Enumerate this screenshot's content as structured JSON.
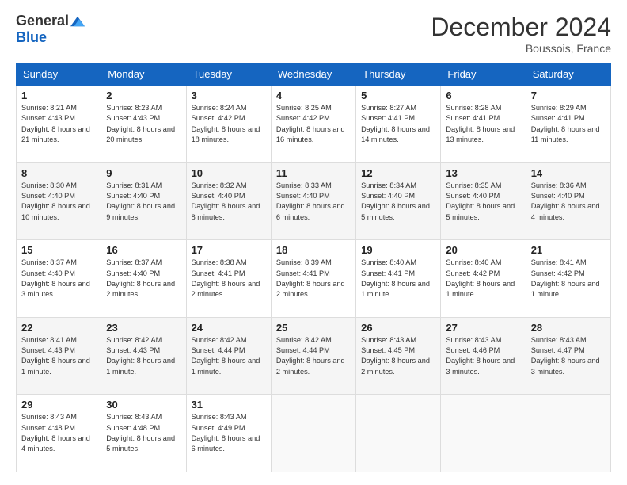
{
  "header": {
    "logo_general": "General",
    "logo_blue": "Blue",
    "title": "December 2024",
    "subtitle": "Boussois, France"
  },
  "days_of_week": [
    "Sunday",
    "Monday",
    "Tuesday",
    "Wednesday",
    "Thursday",
    "Friday",
    "Saturday"
  ],
  "weeks": [
    [
      {
        "day": "1",
        "sunrise": "8:21 AM",
        "sunset": "4:43 PM",
        "daylight": "8 hours and 21 minutes."
      },
      {
        "day": "2",
        "sunrise": "8:23 AM",
        "sunset": "4:43 PM",
        "daylight": "8 hours and 20 minutes."
      },
      {
        "day": "3",
        "sunrise": "8:24 AM",
        "sunset": "4:42 PM",
        "daylight": "8 hours and 18 minutes."
      },
      {
        "day": "4",
        "sunrise": "8:25 AM",
        "sunset": "4:42 PM",
        "daylight": "8 hours and 16 minutes."
      },
      {
        "day": "5",
        "sunrise": "8:27 AM",
        "sunset": "4:41 PM",
        "daylight": "8 hours and 14 minutes."
      },
      {
        "day": "6",
        "sunrise": "8:28 AM",
        "sunset": "4:41 PM",
        "daylight": "8 hours and 13 minutes."
      },
      {
        "day": "7",
        "sunrise": "8:29 AM",
        "sunset": "4:41 PM",
        "daylight": "8 hours and 11 minutes."
      }
    ],
    [
      {
        "day": "8",
        "sunrise": "8:30 AM",
        "sunset": "4:40 PM",
        "daylight": "8 hours and 10 minutes."
      },
      {
        "day": "9",
        "sunrise": "8:31 AM",
        "sunset": "4:40 PM",
        "daylight": "8 hours and 9 minutes."
      },
      {
        "day": "10",
        "sunrise": "8:32 AM",
        "sunset": "4:40 PM",
        "daylight": "8 hours and 8 minutes."
      },
      {
        "day": "11",
        "sunrise": "8:33 AM",
        "sunset": "4:40 PM",
        "daylight": "8 hours and 6 minutes."
      },
      {
        "day": "12",
        "sunrise": "8:34 AM",
        "sunset": "4:40 PM",
        "daylight": "8 hours and 5 minutes."
      },
      {
        "day": "13",
        "sunrise": "8:35 AM",
        "sunset": "4:40 PM",
        "daylight": "8 hours and 5 minutes."
      },
      {
        "day": "14",
        "sunrise": "8:36 AM",
        "sunset": "4:40 PM",
        "daylight": "8 hours and 4 minutes."
      }
    ],
    [
      {
        "day": "15",
        "sunrise": "8:37 AM",
        "sunset": "4:40 PM",
        "daylight": "8 hours and 3 minutes."
      },
      {
        "day": "16",
        "sunrise": "8:37 AM",
        "sunset": "4:40 PM",
        "daylight": "8 hours and 2 minutes."
      },
      {
        "day": "17",
        "sunrise": "8:38 AM",
        "sunset": "4:41 PM",
        "daylight": "8 hours and 2 minutes."
      },
      {
        "day": "18",
        "sunrise": "8:39 AM",
        "sunset": "4:41 PM",
        "daylight": "8 hours and 2 minutes."
      },
      {
        "day": "19",
        "sunrise": "8:40 AM",
        "sunset": "4:41 PM",
        "daylight": "8 hours and 1 minute."
      },
      {
        "day": "20",
        "sunrise": "8:40 AM",
        "sunset": "4:42 PM",
        "daylight": "8 hours and 1 minute."
      },
      {
        "day": "21",
        "sunrise": "8:41 AM",
        "sunset": "4:42 PM",
        "daylight": "8 hours and 1 minute."
      }
    ],
    [
      {
        "day": "22",
        "sunrise": "8:41 AM",
        "sunset": "4:43 PM",
        "daylight": "8 hours and 1 minute."
      },
      {
        "day": "23",
        "sunrise": "8:42 AM",
        "sunset": "4:43 PM",
        "daylight": "8 hours and 1 minute."
      },
      {
        "day": "24",
        "sunrise": "8:42 AM",
        "sunset": "4:44 PM",
        "daylight": "8 hours and 1 minute."
      },
      {
        "day": "25",
        "sunrise": "8:42 AM",
        "sunset": "4:44 PM",
        "daylight": "8 hours and 2 minutes."
      },
      {
        "day": "26",
        "sunrise": "8:43 AM",
        "sunset": "4:45 PM",
        "daylight": "8 hours and 2 minutes."
      },
      {
        "day": "27",
        "sunrise": "8:43 AM",
        "sunset": "4:46 PM",
        "daylight": "8 hours and 3 minutes."
      },
      {
        "day": "28",
        "sunrise": "8:43 AM",
        "sunset": "4:47 PM",
        "daylight": "8 hours and 3 minutes."
      }
    ],
    [
      {
        "day": "29",
        "sunrise": "8:43 AM",
        "sunset": "4:48 PM",
        "daylight": "8 hours and 4 minutes."
      },
      {
        "day": "30",
        "sunrise": "8:43 AM",
        "sunset": "4:48 PM",
        "daylight": "8 hours and 5 minutes."
      },
      {
        "day": "31",
        "sunrise": "8:43 AM",
        "sunset": "4:49 PM",
        "daylight": "8 hours and 6 minutes."
      },
      null,
      null,
      null,
      null
    ]
  ]
}
